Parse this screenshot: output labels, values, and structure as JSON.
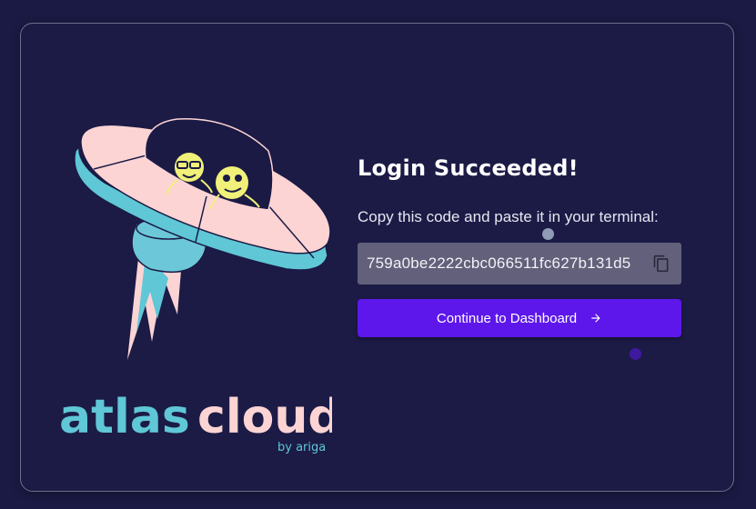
{
  "login": {
    "title": "Login Succeeded!",
    "instruction": "Copy this code and paste it in your terminal:",
    "code": "759a0be2222cbc066511fc627b131d5",
    "continue_label": "Continue to Dashboard"
  },
  "brand": {
    "name_part1": "atlas",
    "name_part2": "cloud",
    "tagline": "by ariga"
  },
  "colors": {
    "background": "#1b1a44",
    "accent": "#5e17eb",
    "code_bg": "#62607a",
    "brand_cyan": "#5fc7d6",
    "brand_pink": "#fcd4d4"
  },
  "icons": {
    "copy": "copy-icon",
    "arrow": "arrow-right-icon"
  }
}
